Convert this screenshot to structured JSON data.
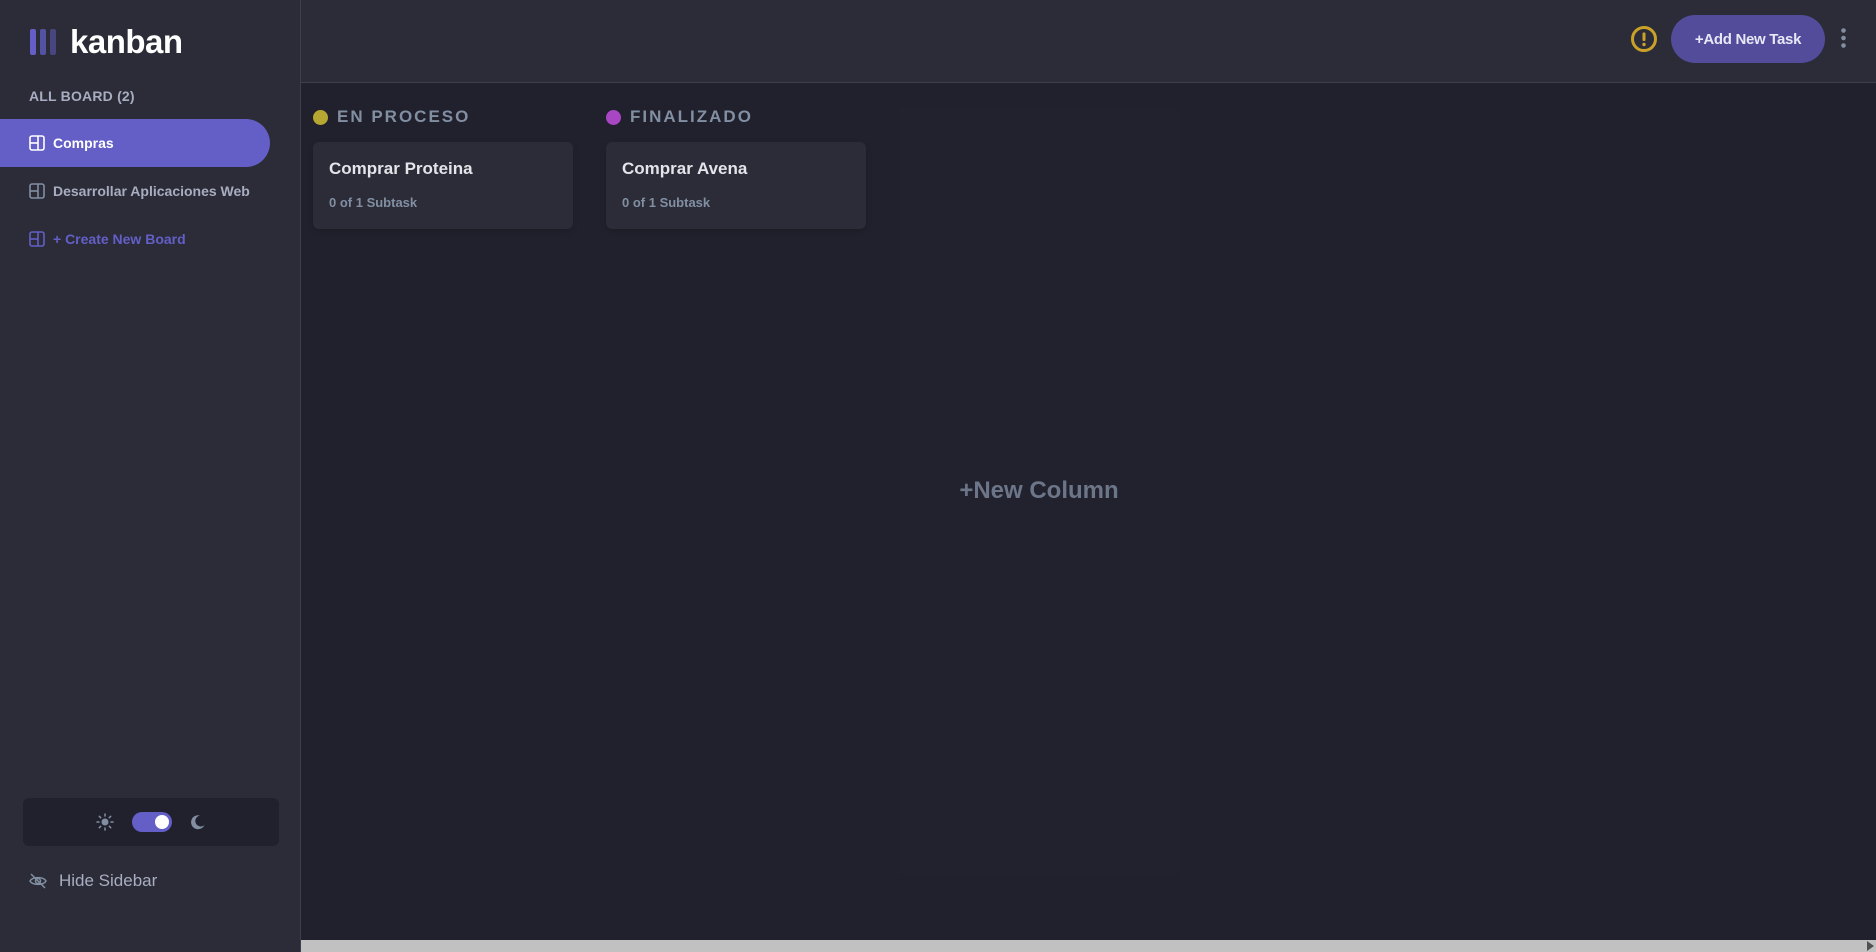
{
  "app": {
    "logo_text": "kanban"
  },
  "sidebar": {
    "board_count_label": "ALL BOARD (2)",
    "boards": [
      {
        "label": "Compras",
        "active": true
      },
      {
        "label": "Desarrollar Aplicaciones Web",
        "active": false
      }
    ],
    "create_label": "+ Create New Board",
    "hide_label": "Hide Sidebar",
    "theme": {
      "mode": "dark"
    }
  },
  "header": {
    "add_task_label": "+Add New Task",
    "icons": [
      "warning-icon",
      "more-vertical-icon"
    ]
  },
  "columns": [
    {
      "title": "EN PROCESO",
      "dot_color": "#b5a731",
      "tasks": [
        {
          "title": "Comprar Proteina",
          "subtasks": "0 of 1 Subtask"
        }
      ]
    },
    {
      "title": "FINALIZADO",
      "dot_color": "#a846c3",
      "tasks": [
        {
          "title": "Comprar Avena",
          "subtasks": "0 of 1 Subtask"
        }
      ]
    }
  ],
  "new_column_label": "+New Column",
  "colors": {
    "accent": "#635fc7",
    "sidebar_bg": "#2b2c37",
    "main_bg": "#20212c",
    "warning": "#c9a227"
  }
}
